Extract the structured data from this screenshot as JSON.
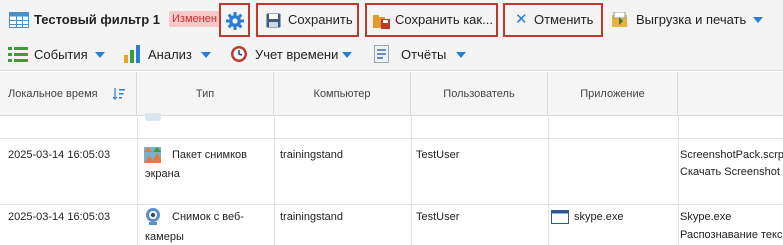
{
  "toolbar1": {
    "filter_title": "Тестовый фильтр 1",
    "changed_badge": "Изменен",
    "save_label": "Сохранить",
    "save_as_label": "Сохранить как...",
    "cancel_label": "Отменить",
    "export_label": "Выгрузка и печать"
  },
  "toolbar2": {
    "events_label": "События",
    "analysis_label": "Анализ",
    "time_label": "Учет времени",
    "reports_label": "Отчёты"
  },
  "columns": [
    "Локальное время",
    "Тип",
    "Компьютер",
    "Пользователь",
    "Приложение"
  ],
  "rows": [
    {
      "time": "2025-03-14 16:05:03",
      "type_line1": "Пакет снимков",
      "type_line2": "экрана",
      "computer": "trainingstand",
      "user": "TestUser",
      "app": "",
      "detail_line1": "ScreenshotPack.scrp",
      "detail_line2": "Скачать Screenshot"
    },
    {
      "time": "2025-03-14 16:05:03",
      "type_line1": "Снимок с веб-",
      "type_line2": "камеры",
      "computer": "trainingstand",
      "user": "TestUser",
      "app": "skype.exe",
      "detail_line1": "Skype.exe",
      "detail_line2": "Распознавание текс"
    }
  ],
  "colors": {
    "highlight_box": "#c0392b",
    "accent_blue": "#2a7fd4",
    "badge_bg": "#f6c8c8"
  }
}
